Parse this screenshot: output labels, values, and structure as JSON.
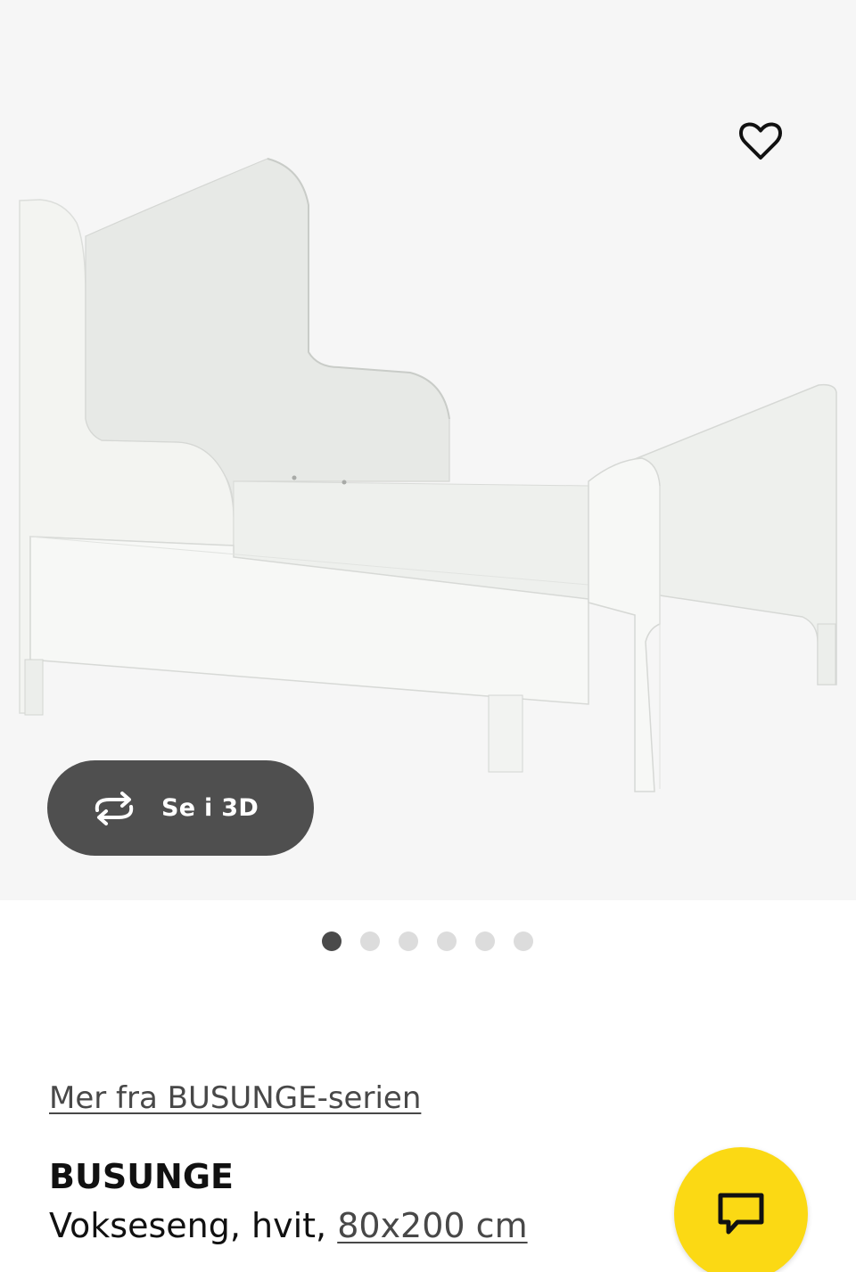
{
  "product_gallery": {
    "image_alt": "BUSUNGE",
    "favorite_icon": "heart-outline-icon",
    "view_3d": {
      "icon": "rotate-3d-icon",
      "label": "Se i 3D"
    },
    "dots": {
      "count": 6,
      "active_index": 0
    }
  },
  "product_info": {
    "series_link": "Mer fra BUSUNGE-serien",
    "name": "BUSUNGE",
    "description": "Vokseseng, hvit, ",
    "size_link": "80x200 cm"
  },
  "chat": {
    "icon": "chat-bubble-icon"
  },
  "colors": {
    "accent_yellow": "#fbd914",
    "pill_gray": "#4f4f4f",
    "dot_active": "#4a4a4a",
    "dot_inactive": "#dcdcdc",
    "image_background": "#f6f6f6"
  }
}
